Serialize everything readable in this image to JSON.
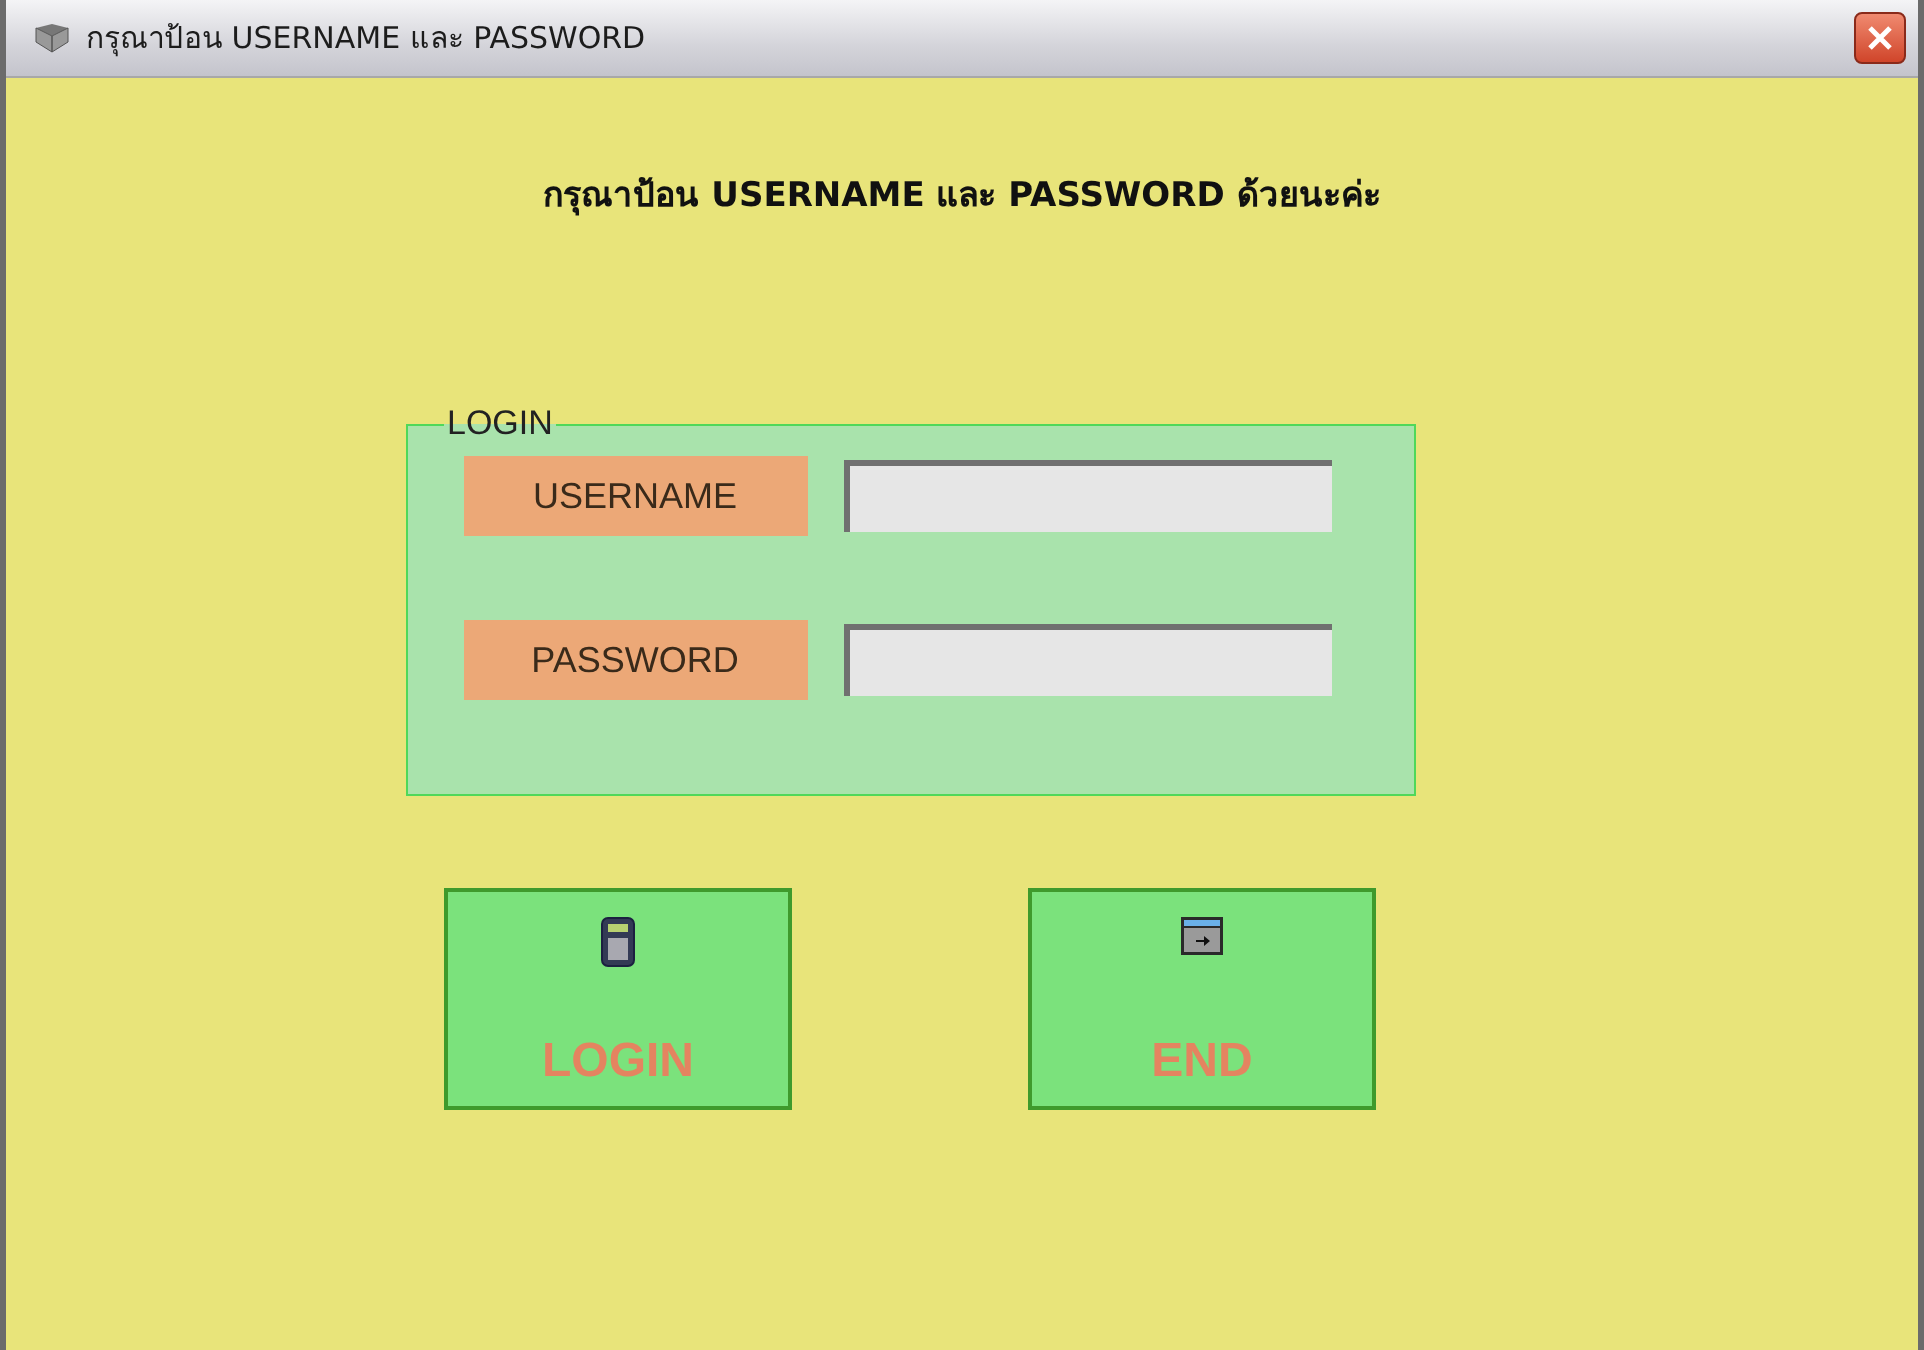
{
  "window": {
    "title": "กรุณาป้อน USERNAME และ PASSWORD"
  },
  "heading": "กรุณาป้อน USERNAME และ PASSWORD ด้วยนะค่ะ",
  "login_group": {
    "legend": "LOGIN",
    "fields": [
      {
        "label": "USERNAME"
      },
      {
        "label": "PASSWORD"
      }
    ]
  },
  "buttons": [
    {
      "label": "LOGIN",
      "kind": "login"
    },
    {
      "label": "END",
      "kind": "end"
    }
  ]
}
